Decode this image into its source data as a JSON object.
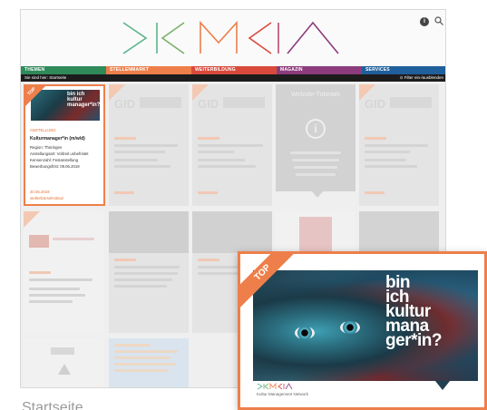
{
  "nav": {
    "items": [
      {
        "label": "THEMEN",
        "color": "#2f8a5a"
      },
      {
        "label": "STELLENMARKT",
        "color": "#ee7f4a"
      },
      {
        "label": "WEITERBILDUNG",
        "color": "#d94a3c"
      },
      {
        "label": "MAGAZIN",
        "color": "#8c3c7c"
      },
      {
        "label": "SERVICES",
        "color": "#1f5f9c"
      }
    ]
  },
  "subbar": {
    "breadcrumb": "Sie sind hier: Startseite",
    "filter": "Filter ein-/ausblenden"
  },
  "card_top": {
    "ribbon": "TOP",
    "thumb_text": "bin ich kultur manager*in?",
    "tag": "ANSTELLUNG",
    "title": "Kulturmanager*in (m/w/d)",
    "lines": [
      "Region: Thüringen",
      "Anstellungsart: Vollzeit unbefristet",
      "Kennenzahl: Festanstellung",
      "Bewerbungsfrist: 09.06.2019"
    ],
    "date": "20.05.2019",
    "sublabel": "stellenbörsefestival"
  },
  "info_bubble": {
    "title": "Website-Tutorials",
    "icon": "info-icon"
  },
  "zoom_card": {
    "ribbon": "TOP",
    "slogan_lines": [
      "bin",
      "ich",
      "kultur",
      "mana",
      "ger*in?"
    ],
    "logo_sub": "Kultur Management Network"
  },
  "page_label": "Startseite",
  "colors": {
    "accent": "#ee7f4a"
  }
}
